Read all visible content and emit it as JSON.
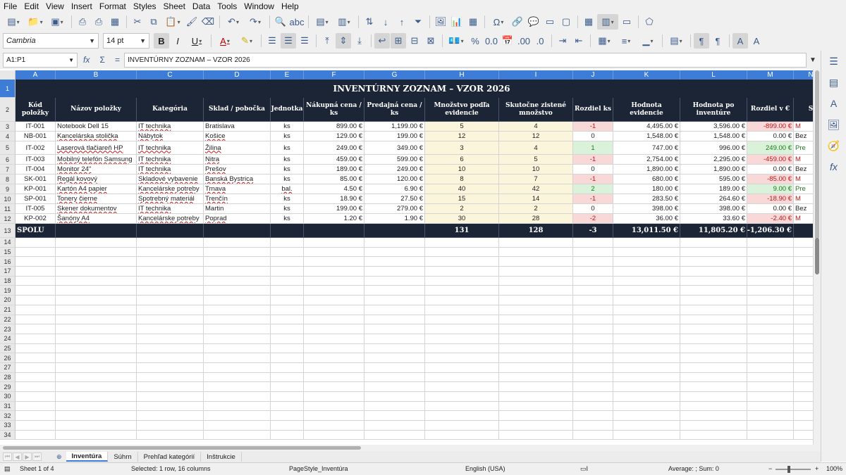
{
  "menu": [
    "File",
    "Edit",
    "View",
    "Insert",
    "Format",
    "Styles",
    "Sheet",
    "Data",
    "Tools",
    "Window",
    "Help"
  ],
  "font": {
    "name": "Cambria",
    "size": "14 pt"
  },
  "namebox": "A1:P1",
  "formula": "INVENTÚRNY ZOZNAM – VZOR 2026",
  "columns": [
    "A",
    "B",
    "C",
    "D",
    "E",
    "F",
    "G",
    "H",
    "I",
    "J",
    "K",
    "L",
    "M",
    "N"
  ],
  "title": "INVENTÚRNY ZOZNAM – VZOR 2026",
  "headers": [
    "Kód položky",
    "Názov položky",
    "Kategória",
    "Sklad / pobočka",
    "Jednotka",
    "Nákupná cena / ks",
    "Predajná cena / ks",
    "Množstvo podľa evidencie",
    "Skutočne zistené množstvo",
    "Rozdiel ks",
    "Hodnota evidencie",
    "Hodnota po inventúre",
    "Rozdiel v €",
    "S"
  ],
  "items": [
    {
      "code": "IT-001",
      "name": "Notebook Dell 15",
      "cat": "IT technika",
      "store": "Bratislava",
      "unit": "ks",
      "buy": "899.00 €",
      "sell": "1,199.00 €",
      "qty_ev": "5",
      "qty_real": "4",
      "diff": "-1",
      "val_ev": "4,495.00 €",
      "val_inv": "3,596.00 €",
      "diff_eur": "-899.00 €",
      "status": "M",
      "sign": "neg"
    },
    {
      "code": "NB-001",
      "name": "Kancelárska stolička",
      "cat": "Nábytok",
      "store": "Košice",
      "unit": "ks",
      "buy": "129.00 €",
      "sell": "199.00 €",
      "qty_ev": "12",
      "qty_real": "12",
      "diff": "0",
      "val_ev": "1,548.00 €",
      "val_inv": "1,548.00 €",
      "diff_eur": "0.00 €",
      "status": "Bez",
      "sign": "zero"
    },
    {
      "code": "IT-002",
      "name": "Laserová tlačiareň HP",
      "cat": "IT technika",
      "store": "Žilina",
      "unit": "ks",
      "buy": "249.00 €",
      "sell": "349.00 €",
      "qty_ev": "3",
      "qty_real": "4",
      "diff": "1",
      "val_ev": "747.00 €",
      "val_inv": "996.00 €",
      "diff_eur": "249.00 €",
      "status": "Pre",
      "sign": "pos"
    },
    {
      "code": "IT-003",
      "name": "Mobilný telefón Samsung",
      "cat": "IT technika",
      "store": "Nitra",
      "unit": "ks",
      "buy": "459.00 €",
      "sell": "599.00 €",
      "qty_ev": "6",
      "qty_real": "5",
      "diff": "-1",
      "val_ev": "2,754.00 €",
      "val_inv": "2,295.00 €",
      "diff_eur": "-459.00 €",
      "status": "M",
      "sign": "neg"
    },
    {
      "code": "IT-004",
      "name": "Monitor 24\"",
      "cat": "IT technika",
      "store": "Prešov",
      "unit": "ks",
      "buy": "189.00 €",
      "sell": "249.00 €",
      "qty_ev": "10",
      "qty_real": "10",
      "diff": "0",
      "val_ev": "1,890.00 €",
      "val_inv": "1,890.00 €",
      "diff_eur": "0.00 €",
      "status": "Bez",
      "sign": "zero"
    },
    {
      "code": "SK-001",
      "name": "Regál kovový",
      "cat": "Skladové vybavenie",
      "store": "Banská Bystrica",
      "unit": "ks",
      "buy": "85.00 €",
      "sell": "120.00 €",
      "qty_ev": "8",
      "qty_real": "7",
      "diff": "-1",
      "val_ev": "680.00 €",
      "val_inv": "595.00 €",
      "diff_eur": "-85.00 €",
      "status": "M",
      "sign": "neg"
    },
    {
      "code": "KP-001",
      "name": "Kartón A4 papier",
      "cat": "Kancelárske potreby",
      "store": "Trnava",
      "unit": "bal.",
      "buy": "4.50 €",
      "sell": "6.90 €",
      "qty_ev": "40",
      "qty_real": "42",
      "diff": "2",
      "val_ev": "180.00 €",
      "val_inv": "189.00 €",
      "diff_eur": "9.00 €",
      "status": "Pre",
      "sign": "pos"
    },
    {
      "code": "SP-001",
      "name": "Tonery čierne",
      "cat": "Spotrebný materiál",
      "store": "Trenčín",
      "unit": "ks",
      "buy": "18.90 €",
      "sell": "27.50 €",
      "qty_ev": "15",
      "qty_real": "14",
      "diff": "-1",
      "val_ev": "283.50 €",
      "val_inv": "264.60 €",
      "diff_eur": "-18.90 €",
      "status": "M",
      "sign": "neg"
    },
    {
      "code": "IT-005",
      "name": "Skener dokumentov",
      "cat": "IT technika",
      "store": "Martin",
      "unit": "ks",
      "buy": "199.00 €",
      "sell": "279.00 €",
      "qty_ev": "2",
      "qty_real": "2",
      "diff": "0",
      "val_ev": "398.00 €",
      "val_inv": "398.00 €",
      "diff_eur": "0.00 €",
      "status": "Bez",
      "sign": "zero"
    },
    {
      "code": "KP-002",
      "name": "Šanóny A4",
      "cat": "Kancelárske potreby",
      "store": "Poprad",
      "unit": "ks",
      "buy": "1.20 €",
      "sell": "1.90 €",
      "qty_ev": "30",
      "qty_real": "28",
      "diff": "-2",
      "val_ev": "36.00 €",
      "val_inv": "33.60 €",
      "diff_eur": "-2.40 €",
      "status": "M",
      "sign": "neg"
    }
  ],
  "totals": {
    "label": "SPOLU",
    "qty_ev": "131",
    "qty_real": "128",
    "diff": "-3",
    "val_ev": "13,011.50 €",
    "val_inv": "11,805.20 €",
    "diff_eur": "-1,206.30 €"
  },
  "sheets": [
    "Inventúra",
    "Súhrn",
    "Prehľad kategórií",
    "Inštrukcie"
  ],
  "active_sheet": "Inventúra",
  "status": {
    "sheet": "Sheet 1 of 4",
    "selection": "Selected: 1 row, 16 columns",
    "pagestyle": "PageStyle_Inventúra",
    "language": "English (USA)",
    "stats": "Average: ; Sum: 0",
    "zoom": "100%"
  },
  "colors": {
    "header_bg": "#1b2536",
    "accent": "#3d7dd8",
    "neg_bg": "#f9d8d8",
    "pos_bg": "#d9f2d9",
    "qty_bg": "#fbf5dc"
  }
}
